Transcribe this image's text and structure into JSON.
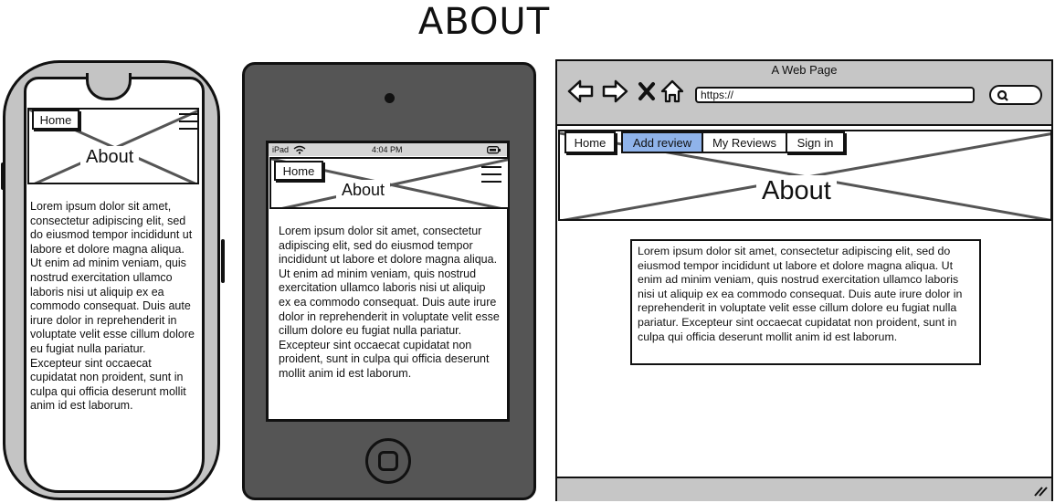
{
  "page": {
    "title": "ABOUT"
  },
  "phone": {
    "home_label": "Home",
    "header_title": "About",
    "body": "Lorem ipsum dolor sit amet, consectetur adipiscing elit, sed do eiusmod tempor incididunt ut labore et dolore magna aliqua. Ut enim ad minim veniam, quis nostrud exercitation ullamco laboris nisi ut aliquip ex ea commodo consequat. Duis aute irure dolor in reprehenderit in voluptate velit esse cillum dolore eu fugiat nulla pariatur. Excepteur sint occaecat cupidatat non proident, sunt in culpa qui officia deserunt mollit anim id est laborum."
  },
  "tablet": {
    "status_left": "iPad",
    "status_time": "4:04 PM",
    "home_label": "Home",
    "header_title": "About",
    "body": "Lorem ipsum dolor sit amet, consectetur adipiscing elit, sed do eiusmod tempor incididunt ut labore et dolore magna aliqua. Ut enim ad minim veniam, quis nostrud exercitation ullamco laboris nisi ut aliquip ex ea commodo consequat. Duis aute irure dolor in reprehenderit in voluptate velit esse cillum dolore eu fugiat nulla pariatur. Excepteur sint occaecat cupidatat non proident, sunt in culpa qui officia deserunt mollit anim id est laborum."
  },
  "browser": {
    "window_title": "A Web Page",
    "url": "https://",
    "nav": [
      "Home",
      "Add review",
      "My Reviews",
      "Sign in"
    ],
    "active_color": "#8fb3ea",
    "header_title": "About",
    "body": "Lorem ipsum dolor sit amet, consectetur adipiscing elit, sed do eiusmod tempor incididunt ut labore et dolore magna aliqua. Ut enim ad minim veniam, quis nostrud exercitation ullamco laboris nisi ut aliquip ex ea commodo consequat. Duis aute irure dolor in reprehenderit in voluptate velit esse cillum dolore eu fugiat nulla pariatur. Excepteur sint occaecat cupidatat non proident, sunt in culpa qui officia deserunt mollit anim id est laborum."
  },
  "icons": [
    "back-arrow-icon",
    "forward-arrow-icon",
    "close-icon",
    "home-icon",
    "search-icon",
    "resize-grip-icon",
    "hamburger-menu-icon",
    "wifi-icon",
    "battery-icon",
    "tablet-home-button-icon"
  ]
}
